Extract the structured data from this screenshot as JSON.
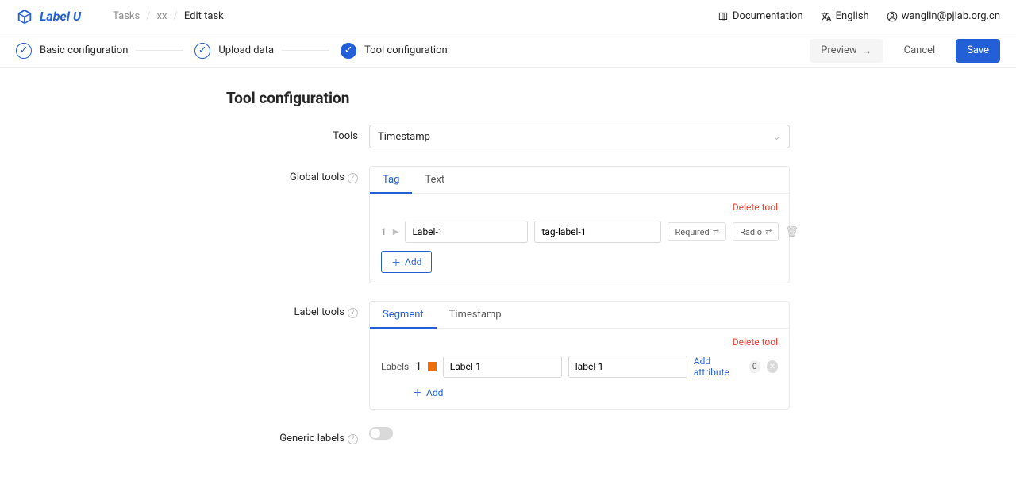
{
  "brand": "Label U",
  "crumbs": {
    "a": "Tasks",
    "b": "xx",
    "c": "Edit task"
  },
  "top": {
    "docs": "Documentation",
    "lang": "English",
    "user": "wanglin@pjlab.org.cn"
  },
  "steps": {
    "s1": "Basic configuration",
    "s2": "Upload data",
    "s3": "Tool configuration"
  },
  "actions": {
    "preview": "Preview",
    "cancel": "Cancel",
    "save": "Save"
  },
  "heading": "Tool configuration",
  "fields": {
    "tools": "Tools",
    "global": "Global tools",
    "label": "Label tools",
    "generic": "Generic labels"
  },
  "toolsSelect": "Timestamp",
  "globalTabs": {
    "tag": "Tag",
    "text": "Text"
  },
  "labelTabs": {
    "segment": "Segment",
    "timestamp": "Timestamp"
  },
  "deleteTool": "Delete tool",
  "tagRow": {
    "num": "1",
    "name": "Label-1",
    "value": "tag-label-1",
    "required": "Required",
    "radio": "Radio"
  },
  "addBtn": "Add",
  "labels": {
    "title": "Labels",
    "num": "1",
    "name": "Label-1",
    "value": "label-1",
    "addAttr": "Add attribute",
    "attrCount": "0"
  }
}
